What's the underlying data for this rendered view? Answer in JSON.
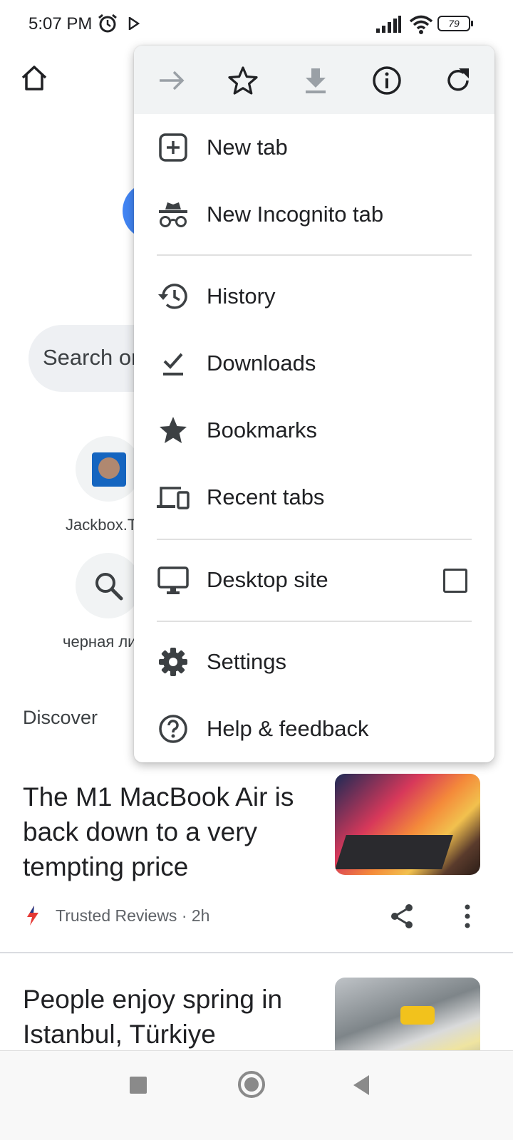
{
  "status_bar": {
    "time": "5:07 PM",
    "battery": "79",
    "icons": [
      "alarm-icon",
      "play-icon",
      "signal-icon",
      "wifi-icon",
      "battery-icon"
    ]
  },
  "page": {
    "search_placeholder": "Search or type web address",
    "shortcuts": [
      {
        "label": "Jackbox.TV",
        "icon": "jackbox-favicon"
      },
      {
        "label": "черная лисица",
        "icon": "search-icon"
      }
    ],
    "discover_label": "Discover",
    "articles": [
      {
        "title": "The M1 MacBook Air is back down to a very tempting price",
        "source": "Trusted Reviews · 2h",
        "thumbnail": "macbook-thumbnail"
      },
      {
        "title": "People enjoy spring in Istanbul, Türkiye",
        "thumbnail": "istanbul-thumbnail"
      }
    ]
  },
  "menu": {
    "toolbar": [
      {
        "name": "forward",
        "icon": "arrow-forward-icon",
        "enabled": false
      },
      {
        "name": "bookmark",
        "icon": "star-outline-icon",
        "enabled": true
      },
      {
        "name": "download",
        "icon": "download-icon",
        "enabled": false
      },
      {
        "name": "page-info",
        "icon": "info-icon",
        "enabled": true
      },
      {
        "name": "reload",
        "icon": "refresh-icon",
        "enabled": true
      }
    ],
    "items": [
      {
        "label": "New tab",
        "icon": "add-box-icon"
      },
      {
        "label": "New Incognito tab",
        "icon": "incognito-icon"
      },
      {
        "label": "History",
        "icon": "history-icon"
      },
      {
        "label": "Downloads",
        "icon": "download-done-icon"
      },
      {
        "label": "Bookmarks",
        "icon": "star-icon"
      },
      {
        "label": "Recent tabs",
        "icon": "devices-icon"
      },
      {
        "label": "Desktop site",
        "icon": "desktop-icon",
        "checked": false
      },
      {
        "label": "Settings",
        "icon": "settings-icon"
      },
      {
        "label": "Help & feedback",
        "icon": "help-icon"
      }
    ]
  },
  "colors": {
    "menu_toolbar_bg": "#f1f3f4",
    "icon": "#3c4043",
    "disabled_icon": "#9aa0a6",
    "google_blue": "#4285f4"
  }
}
